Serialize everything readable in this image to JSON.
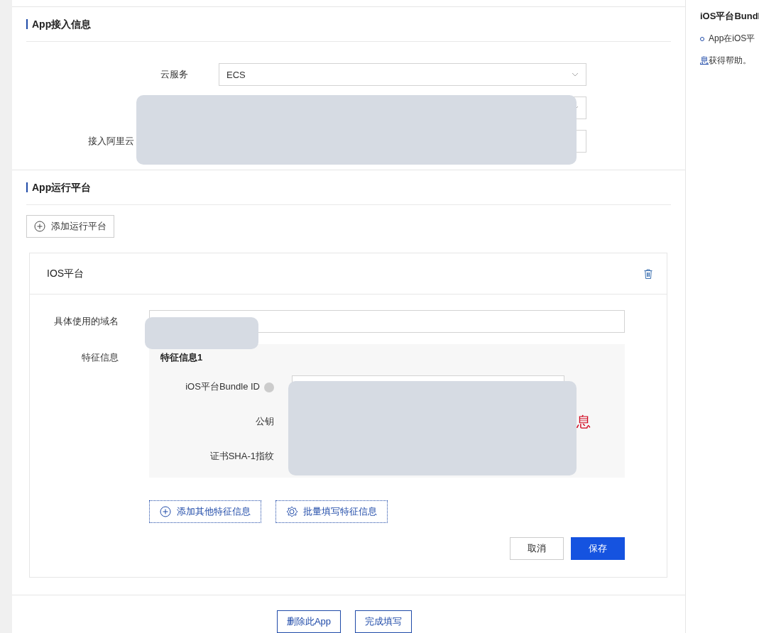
{
  "access_section": {
    "title": "App接入信息",
    "fields": [
      {
        "kind": "select",
        "label": "云服务",
        "value": "ECS"
      },
      {
        "kind": "select"
      },
      {
        "kind": "input",
        "label": "接入阿里云"
      }
    ]
  },
  "platform_section": {
    "title": "App运行平台",
    "add_button": "添加运行平台",
    "platform_card": {
      "title": "IOS平台",
      "domain_label": "具体使用的域名",
      "feature_label": "特征信息",
      "feature_group": {
        "title": "特征信息1",
        "rows": [
          {
            "label": "iOS平台Bundle ID",
            "help": true
          },
          {
            "label": "公钥",
            "help": false
          },
          {
            "label": "证书SHA-1指纹",
            "help": false
          }
        ],
        "error_text": "息"
      },
      "buttons": [
        {
          "label": "添加其他特征信息"
        },
        {
          "label": "批量填写特征信息"
        }
      ],
      "cancel": "取消",
      "save": "保存"
    }
  },
  "footer_buttons": [
    "删除此App",
    "完成填写"
  ],
  "help_panel": {
    "title": "iOS平台Bundl",
    "items": [
      {
        "text": "App在iOS平"
      }
    ],
    "link": "息",
    "after_link": "获得帮助。"
  }
}
